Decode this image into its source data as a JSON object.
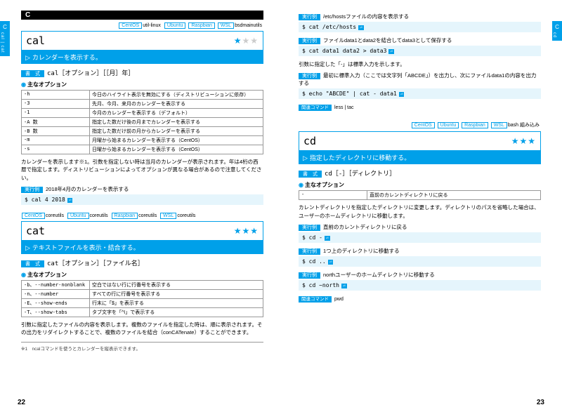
{
  "section_letter": "C",
  "tab_left": {
    "letter": "C",
    "sub": "cal | cat"
  },
  "tab_right": {
    "letter": "C",
    "sub": "cd"
  },
  "platforms": {
    "cal": [
      "CentOS",
      "util-linux",
      "Ubuntu",
      "Raspbian",
      "WSL",
      "bsdmainutils"
    ],
    "cat": [
      "CentOS",
      "coreutils",
      "Ubuntu",
      "coreutils",
      "Raspbian",
      "coreutils",
      "WSL",
      "coreutils"
    ],
    "cd": [
      "CentOS",
      "Ubuntu",
      "Raspbian",
      "WSL",
      "bash 組み込み"
    ]
  },
  "cal": {
    "name": "cal",
    "stars": "★☆☆",
    "desc": "カレンダーを表示する。",
    "syntax_tag": "書　式",
    "syntax": "cal［オプション］［［月］年］",
    "opt_head": "主なオプション",
    "opts": [
      [
        "-h",
        "今日のハイライト表示を無効にする（ディストリビューションに依存）"
      ],
      [
        "-3",
        "先月、今月、来月のカレンダーを表示する"
      ],
      [
        "-1",
        "今月のカレンダーを表示する（デフォルト）"
      ],
      [
        "-A 数",
        "指定した数だけ後の月までカレンダーを表示する"
      ],
      [
        "-B 数",
        "指定した数だけ前の月からカレンダーを表示する"
      ],
      [
        "-m",
        "月曜から始まるカレンダーを表示する（CentOS）"
      ],
      [
        "-s",
        "日曜から始まるカレンダーを表示する（CentOS）"
      ]
    ],
    "body": "カレンダーを表示します※1。引数を指定しない時は当月のカレンダーが表示されます。年は4桁の西暦で指定します。ディストリビューションによってオプションが異なる場合があるので注意してください。",
    "ex_tag": "実行例",
    "ex_desc": "2018年4月のカレンダーを表示する",
    "code": "$ cal 4 2018"
  },
  "cat": {
    "name": "cat",
    "stars": "★★★",
    "desc": "テキストファイルを表示・結合する。",
    "syntax": "cat［オプション］［ファイル名］",
    "opts": [
      [
        "-b、--number-nonblank",
        "空白ではない行に行番号を表示する"
      ],
      [
        "-n、--number",
        "すべての行に行番号を表示する"
      ],
      [
        "-E、--show-ends",
        "行末に「$」を表示する"
      ],
      [
        "-T、--show-tabs",
        "タブ文字を「^I」で表示する"
      ]
    ],
    "body": "引数に指定したファイルの内容を表示します。複数のファイルを指定した時は、順に表示されます。その出力をリダイレクトすることで、複数のファイルを結合（conCATenate）することができます。",
    "examples": [
      {
        "desc": "/etc/hostsファイルの内容を表示する",
        "code": "$ cat /etc/hosts"
      },
      {
        "desc": "ファイルdata1とdata2を結合してdata3として保存する",
        "code": "$ cat data1 data2 > data3"
      }
    ],
    "body2": "引数に指定した「-」は標準入力を示します。",
    "ex3_desc": "最初に標準入力（ここでは文字列「ABCDE」）を出力し、次にファイルdata1の内容を出力する",
    "ex3_code": "$ echo \"ABCDE\" | cat - data1",
    "related_tag": "関連コマンド",
    "related": "less | tac"
  },
  "cd": {
    "name": "cd",
    "stars": "★★★",
    "desc": "指定したディレクトリに移動する。",
    "syntax": "cd［-］［ディレクトリ］",
    "opts": [
      [
        "-",
        "直前のカレントディレクトリに戻る"
      ]
    ],
    "body": "カレントディレクトリを指定したディレクトリに変更します。ディレクトリのパスを省略した場合は、ユーザーのホームディレクトリに移動します。",
    "examples": [
      {
        "desc": "直前のカレントディレクトリに戻る",
        "code": "$ cd -"
      },
      {
        "desc": "1つ上のディレクトリに移動する",
        "code": "$ cd .."
      },
      {
        "desc": "northユーザーのホームディレクトリに移動する",
        "code": "$ cd ~north"
      }
    ],
    "related": "pwd"
  },
  "footnote": "※1　ncalコマンドを使うとカレンダーを縦表示できます。",
  "page_left": "22",
  "page_right": "23",
  "ret": "⏎"
}
